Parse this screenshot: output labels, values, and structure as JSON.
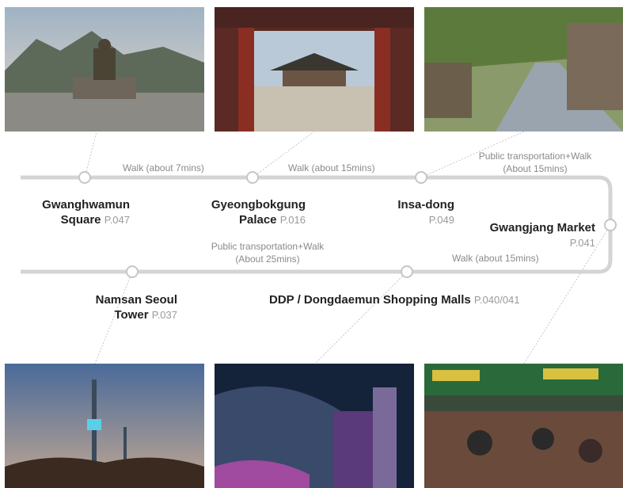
{
  "photos": [
    {
      "name": "gwanghwamun-square-photo",
      "icon": "statue-mountain-photo"
    },
    {
      "name": "gyeongbokgung-palace-photo",
      "icon": "palace-gate-photo"
    },
    {
      "name": "insa-dong-photo",
      "icon": "tree-street-photo"
    },
    {
      "name": "namsan-seoul-tower-photo",
      "icon": "tower-night-photo"
    },
    {
      "name": "ddp-photo",
      "icon": "ddp-night-photo"
    },
    {
      "name": "gwangjang-market-photo",
      "icon": "market-stalls-photo"
    }
  ],
  "stops": {
    "gwanghwamun": {
      "line1": "Gwanghwamun",
      "line2": "Square",
      "page": "P.047"
    },
    "gyeongbokgung": {
      "line1": "Gyeongbokgung",
      "line2": "Palace",
      "page": "P.016"
    },
    "insadong": {
      "line1": "Insa-dong",
      "page": "P.049"
    },
    "gwangjang": {
      "line1": "Gwangjang Market",
      "page": "P.041"
    },
    "ddp": {
      "line1": "DDP / Dongdaemun Shopping Malls",
      "page": "P.040/041"
    },
    "namsan": {
      "line1": "Namsan Seoul",
      "line2": "Tower",
      "page": "P.037"
    }
  },
  "segments": {
    "s1": "Walk (about 7mins)",
    "s2": "Walk (about 15mins)",
    "s3_line1": "Public transportation+Walk",
    "s3_line2": "(About 15mins)",
    "s4": "Walk (about 15mins)",
    "s5_line1": "Public transportation+Walk",
    "s5_line2": "(About 25mins)"
  },
  "colors": {
    "route": "#d4d4d4",
    "node_fill": "#ffffff",
    "text": "#222222",
    "muted": "#8a8a8a",
    "page_ref": "#9a9a9a"
  }
}
